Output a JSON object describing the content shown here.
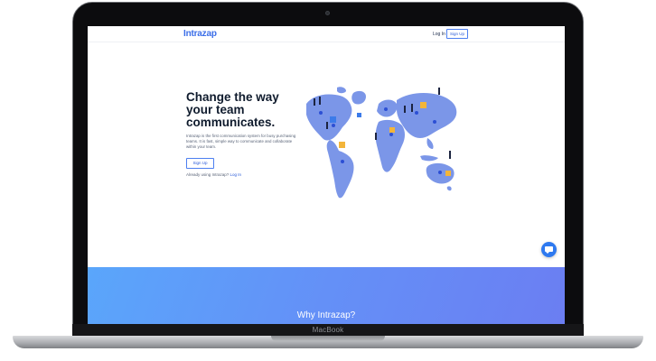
{
  "device": {
    "label": "MacBook"
  },
  "nav": {
    "logo": "Intrazap",
    "login": "Log In",
    "signup": "Sign Up"
  },
  "hero": {
    "title": "Change the way your team communicates.",
    "description": "Intrazap is the first communication system for busy purchasing teams. It is fast, simple way to communicate and collaborate within your team.",
    "signup": "Sign Up",
    "already_text": "Already using Intrazap?",
    "login_link": "Log In"
  },
  "section": {
    "title": "Why Intrazap?"
  },
  "colors": {
    "brand": "#3b6ee8",
    "map": "#7b96e8",
    "band_start": "#5aa6fb",
    "band_end": "#6b7ef2",
    "chat": "#2e79f0"
  },
  "icons": {
    "chat": "chat-bubble-icon",
    "camera": "camera-icon"
  }
}
